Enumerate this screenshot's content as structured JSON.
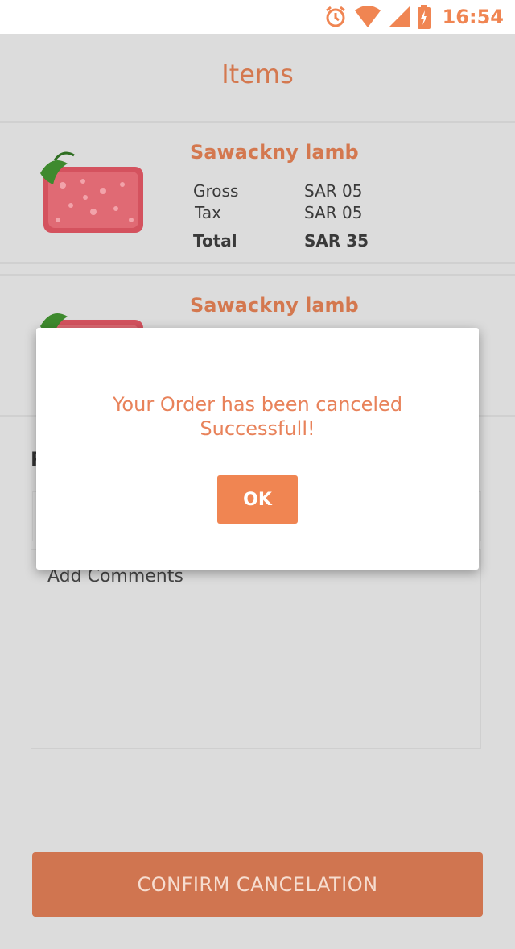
{
  "status_bar": {
    "time": "16:54",
    "icons": [
      "alarm-icon",
      "wifi-icon",
      "signal-icon",
      "battery-charging-icon"
    ]
  },
  "header": {
    "title": "Items"
  },
  "items": [
    {
      "name": "Sawackny lamb",
      "image": "minced-lamb-image",
      "gross_label": "Gross",
      "gross_value": "SAR 05",
      "tax_label": "Tax",
      "tax_value": "SAR 05",
      "total_label": "Total",
      "total_value": "SAR 35"
    },
    {
      "name": "Sawackny lamb",
      "image": "minced-lamb-image"
    }
  ],
  "form": {
    "reason_label_fragment": "R",
    "comments_placeholder": "Add Comments",
    "confirm_label": "CONFIRM CANCELATION"
  },
  "dialog": {
    "message": "Your Order has been canceled Successfull!",
    "ok_label": "OK"
  },
  "colors": {
    "accent": "#f08552",
    "title": "#d4784f",
    "confirm_button": "#d07550",
    "background": "#dcdcdc"
  }
}
